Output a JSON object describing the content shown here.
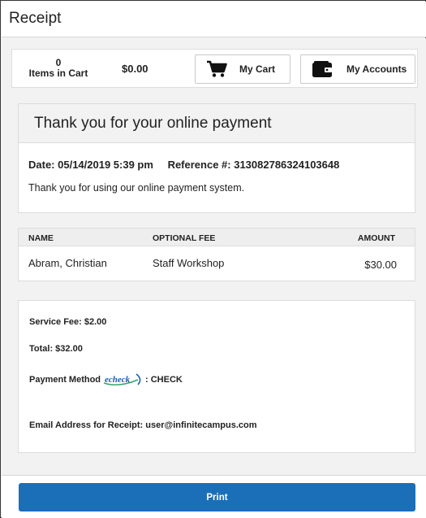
{
  "window": {
    "title": "Receipt"
  },
  "cart_bar": {
    "items_count": "0",
    "items_label": "Items in Cart",
    "total": "$0.00",
    "my_cart_label": "My Cart",
    "my_accounts_label": "My Accounts",
    "my_cart_icon": "shopping-cart-icon",
    "my_accounts_icon": "wallet-icon"
  },
  "confirmation": {
    "heading": "Thank you for your online payment",
    "date": "Date: 05/14/2019 5:39 pm",
    "reference": "Reference #: 313082786324103648",
    "message": "Thank you for using our online payment system."
  },
  "fee_table": {
    "columns": [
      "NAME",
      "OPTIONAL FEE",
      "AMOUNT"
    ],
    "rows": [
      {
        "name": "Abram, Christian",
        "fee": "Staff Workshop",
        "amount": "$30.00"
      }
    ]
  },
  "summary": {
    "service_fee": "Service Fee: $2.00",
    "total": "Total: $32.00",
    "payment_method_label": "Payment Method",
    "payment_method_logo": "echeck",
    "payment_method_value": ": CHECK",
    "email": "Email Address for Receipt: user@infinitecampus.com"
  },
  "footer": {
    "print_label": "Print"
  },
  "colors": {
    "primary": "#1a6fb8",
    "background": "#f2f2f2",
    "card": "#ffffff",
    "echeck_blue": "#1d5aa5",
    "echeck_green": "#3aa36b"
  }
}
